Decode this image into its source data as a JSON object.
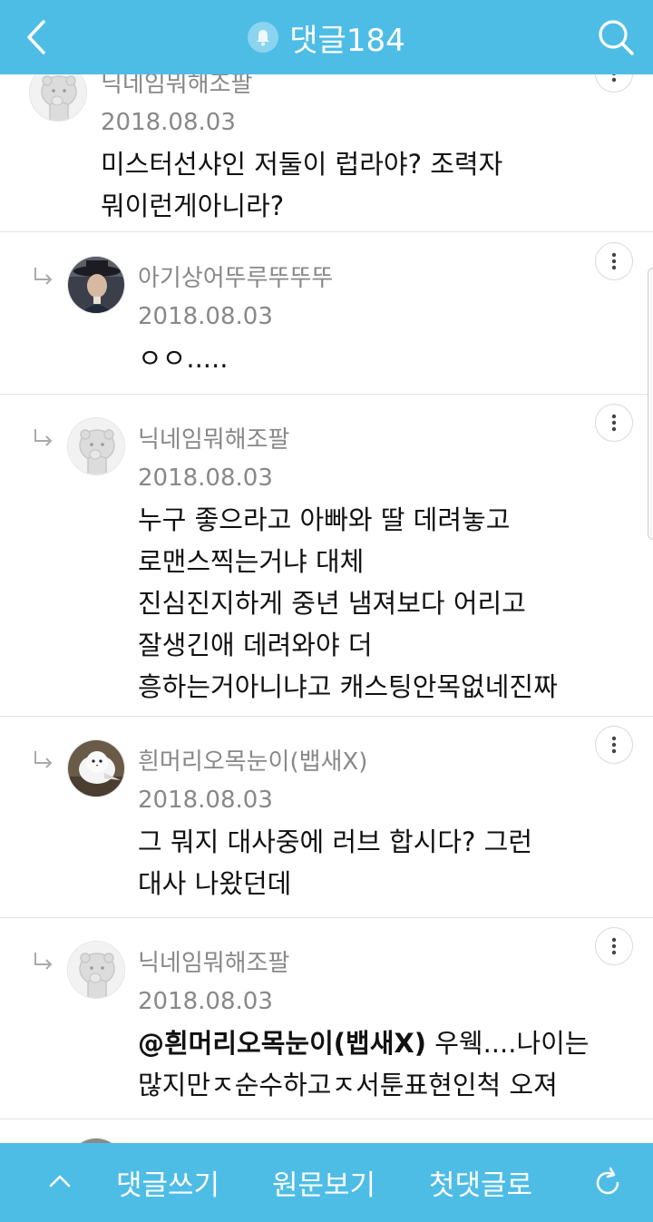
{
  "header": {
    "title": "댓글184",
    "back_icon": "chevron-left-icon",
    "bell_icon": "bell-icon",
    "search_icon": "search-icon",
    "accent": "#4ebde6"
  },
  "comments": [
    {
      "nickname": "닉네임뭐해조팔",
      "date": "2018.08.03",
      "lines": [
        "미스터선샤인 저둘이 럽라야?  조력자",
        "뭐이런게아니라?"
      ],
      "reply": false,
      "avatar": "default-avatar"
    },
    {
      "nickname": "아기상어뚜루뚜뚜뚜",
      "date": "2018.08.03",
      "lines": [
        "ㅇㅇ....."
      ],
      "reply": true,
      "avatar": "photo-avatar-man-hat"
    },
    {
      "nickname": "닉네임뭐해조팔",
      "date": "2018.08.03",
      "lines": [
        "누구 좋으라고 아빠와 딸 데려놓고",
        "로맨스찍는거냐 대체",
        "진심진지하게 중년 냄져보다 어리고",
        "잘생긴애 데려와야 더",
        "흥하는거아니냐고 캐스팅안목없네진짜"
      ],
      "reply": true,
      "avatar": "default-avatar"
    },
    {
      "nickname": "흰머리오목눈이(뱁새X)",
      "date": "2018.08.03",
      "lines": [
        "그 뭐지 대사중에 러브 합시다?  그런",
        "대사 나왔던데"
      ],
      "reply": true,
      "avatar": "photo-avatar-white-bird"
    },
    {
      "nickname": "닉네임뭐해조팔",
      "date": "2018.08.03",
      "mention": "@흰머리오목눈이(뱁새X)",
      "lines": [
        " 우웩....나이는",
        "많지만ㅈ순수하고ㅈ서툰표현인척 오져"
      ],
      "reply": true,
      "avatar": "default-avatar"
    }
  ],
  "footer": {
    "write": "댓글쓰기",
    "original": "원문보기",
    "first": "첫댓글로",
    "up_icon": "chevron-up-icon",
    "refresh_icon": "refresh-icon"
  },
  "more_icon": "more-vertical-icon",
  "reply_icon": "reply-arrow-icon"
}
